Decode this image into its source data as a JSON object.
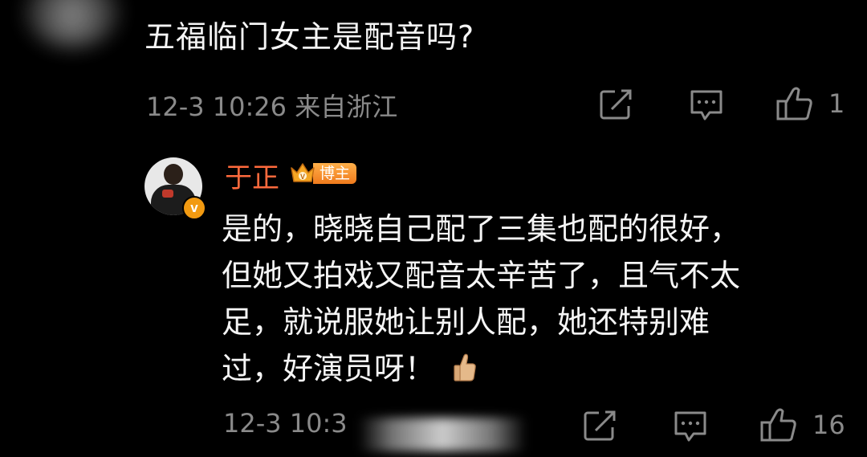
{
  "question": {
    "text": "五福临门女主是配音吗?",
    "meta": "12-3 10:26 来自浙江",
    "like_count": "1"
  },
  "reply": {
    "author": "于正",
    "badge_label": "博主",
    "verified_mark": "v",
    "lines": [
      "是的，晓晓自己配了三集也配的很好，",
      "但她又拍戏又配音太辛苦了，且气不太",
      "足，就说服她让别人配，她还特别难",
      "过，好演员呀！"
    ],
    "meta_time": "12-3 10:3",
    "like_count": "16"
  },
  "colors": {
    "background": "#000000",
    "text": "#f5f5f5",
    "meta": "#8a8a8a",
    "author": "#ff6a3d",
    "badge": "#f07a1c",
    "verified": "#f29a11"
  },
  "icons": [
    "share-icon",
    "comment-icon",
    "like-icon",
    "thumbs-up-emoji"
  ]
}
